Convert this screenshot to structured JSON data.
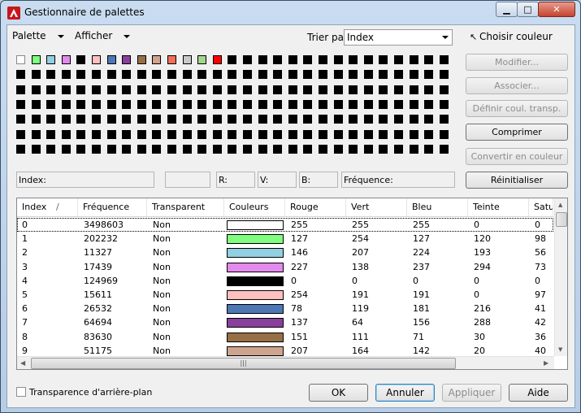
{
  "window": {
    "title": "Gestionnaire de palettes",
    "close_glyph": "✕",
    "min_glyph": "▁",
    "max_glyph": "□"
  },
  "menus": {
    "palette": "Palette",
    "afficher": "Afficher"
  },
  "sort": {
    "label": "Trier par:",
    "value": "Index"
  },
  "choose_color": "Choisir couleur",
  "palette": {
    "colors": [
      "#ffffff",
      "#7ffe7f",
      "#92cfe0",
      "#e38aed",
      "#000000",
      "#fec0c0",
      "#4e77b5",
      "#89409c",
      "#976f47",
      "#cfa48e",
      "#ef7055",
      "#c8c8c8",
      "#a3d58b",
      "#ff0000"
    ],
    "fill_color": "#000000",
    "cols": 29,
    "rows": 7
  },
  "info": {
    "index": "Index:",
    "r": "R:",
    "v": "V:",
    "b": "B:",
    "frequency": "Fréquence:"
  },
  "side_buttons": [
    "Modifier...",
    "Associer...",
    "Définir coul. transp.",
    "Comprimer",
    "Convertir en couleur",
    "Réinitialiser"
  ],
  "table": {
    "headers": [
      "Index",
      "Fréquence",
      "Transparent",
      "Couleurs",
      "Rouge",
      "Vert",
      "Bleu",
      "Teinte",
      "Satu"
    ],
    "rows": [
      {
        "index": "0",
        "freq": "3498603",
        "transp": "Non",
        "color": "#ffffff",
        "r": "255",
        "g": "255",
        "b": "255",
        "hue": "0",
        "sat": "0"
      },
      {
        "index": "1",
        "freq": "202232",
        "transp": "Non",
        "color": "#7ffe7f",
        "r": "127",
        "g": "254",
        "b": "127",
        "hue": "120",
        "sat": "98"
      },
      {
        "index": "2",
        "freq": "11327",
        "transp": "Non",
        "color": "#92cfe0",
        "r": "146",
        "g": "207",
        "b": "224",
        "hue": "193",
        "sat": "56"
      },
      {
        "index": "3",
        "freq": "17439",
        "transp": "Non",
        "color": "#e38aed",
        "r": "227",
        "g": "138",
        "b": "237",
        "hue": "294",
        "sat": "73"
      },
      {
        "index": "4",
        "freq": "124969",
        "transp": "Non",
        "color": "#000000",
        "r": "0",
        "g": "0",
        "b": "0",
        "hue": "0",
        "sat": "0"
      },
      {
        "index": "5",
        "freq": "15611",
        "transp": "Non",
        "color": "#febfbf",
        "r": "254",
        "g": "191",
        "b": "191",
        "hue": "0",
        "sat": "97"
      },
      {
        "index": "6",
        "freq": "26532",
        "transp": "Non",
        "color": "#4e77b5",
        "r": "78",
        "g": "119",
        "b": "181",
        "hue": "216",
        "sat": "41"
      },
      {
        "index": "7",
        "freq": "64694",
        "transp": "Non",
        "color": "#89409c",
        "r": "137",
        "g": "64",
        "b": "156",
        "hue": "288",
        "sat": "42"
      },
      {
        "index": "8",
        "freq": "83630",
        "transp": "Non",
        "color": "#976f47",
        "r": "151",
        "g": "111",
        "b": "71",
        "hue": "30",
        "sat": "36"
      },
      {
        "index": "9",
        "freq": "51175",
        "transp": "Non",
        "color": "#cfa48e",
        "r": "207",
        "g": "164",
        "b": "142",
        "hue": "20",
        "sat": "40"
      }
    ]
  },
  "scroll_grip": "|||",
  "bottom": {
    "transparency_label": "Transparence d'arrière-plan",
    "ok": "OK",
    "cancel": "Annuler",
    "apply": "Appliquer",
    "help": "Aide"
  }
}
